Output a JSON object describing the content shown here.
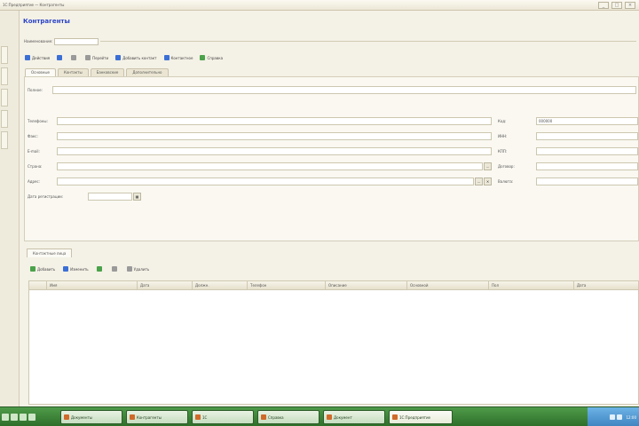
{
  "window": {
    "title": "1С:Предприятие — Контрагенты",
    "buttons": [
      "_",
      "□",
      "×"
    ]
  },
  "document": {
    "title": "Контрагенты"
  },
  "header": {
    "label": "Наименование:",
    "value": ""
  },
  "toolbar": {
    "items": [
      {
        "label": "Действия",
        "icon": "actions-icon"
      },
      {
        "label": "",
        "icon": "save-icon"
      },
      {
        "label": "",
        "icon": "copy-icon"
      },
      {
        "label": "Перейти",
        "icon": "goto-icon"
      },
      {
        "label": "Добавить контакт",
        "icon": "add-contact-icon"
      },
      {
        "label": "Контактное",
        "icon": "contact-icon"
      },
      {
        "label": "Справка",
        "icon": "help-icon"
      }
    ]
  },
  "tabs": [
    "Основные",
    "Контакты",
    "Банковские",
    "Дополнительно"
  ],
  "form": {
    "full_name_label": "Полное:",
    "left_fields": [
      {
        "label": "Телефоны:",
        "value": ""
      },
      {
        "label": "Факс:",
        "value": ""
      },
      {
        "label": "E-mail:",
        "value": ""
      },
      {
        "label": "Страна:",
        "value": ""
      },
      {
        "label": "Адрес:",
        "value": ""
      }
    ],
    "right_fields": [
      {
        "label": "Код:",
        "value": "000000"
      },
      {
        "label": "ИНН:",
        "value": ""
      },
      {
        "label": "КПП:",
        "value": ""
      },
      {
        "label": "Договор:",
        "value": ""
      },
      {
        "label": "Валюта:",
        "value": ""
      }
    ],
    "date_label": "Дата регистрации:",
    "date_value": ""
  },
  "bottom_tab": "Контактные лица",
  "bottom_toolbar": [
    {
      "label": "Добавить",
      "icon": "add-icon"
    },
    {
      "label": "Изменить",
      "icon": "edit-icon"
    },
    {
      "label": "",
      "icon": "check-icon"
    },
    {
      "label": "",
      "icon": "delete-icon"
    },
    {
      "label": "Удалить",
      "icon": "remove-icon"
    }
  ],
  "table": {
    "columns": [
      "",
      "Имя",
      "Дата",
      "Должн.",
      "Телефон",
      "Описание",
      "Основной",
      "Пол",
      "Дата"
    ]
  },
  "taskbar": {
    "tasks": [
      "Документы",
      "Контрагенты",
      "1С",
      "Справка",
      "Документ",
      "1С:Предприятие"
    ],
    "active_index": 5,
    "clock": "12:00"
  }
}
